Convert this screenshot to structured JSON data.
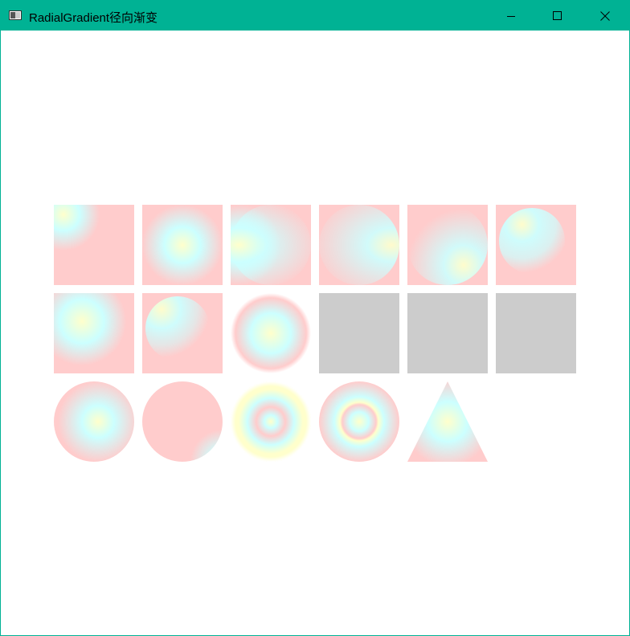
{
  "window": {
    "title": "RadialGradient径向渐变",
    "controls": {
      "minimize": "minimize-icon",
      "maximize": "maximize-icon",
      "close": "close-icon"
    }
  },
  "colors": {
    "titlebar": "#00b294",
    "background": "#ffffff",
    "gradient_center": "#ffffcc",
    "gradient_mid": "#ccffff",
    "gradient_outer": "#ffcccc",
    "placeholder_gray": "#cccccc"
  }
}
